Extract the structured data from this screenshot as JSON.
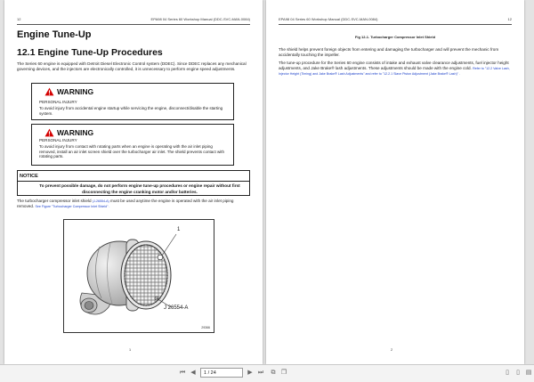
{
  "left_page": {
    "running_header_left": "12",
    "running_header_right": "EPA98 04 Series 60 Workshop Manual (DDC-SVC-MAN-0084)",
    "chapter_title": "Engine Tune-Up",
    "section_title": "12.1 Engine Tune-Up Procedures",
    "intro_text": "The Series 60 engine is equipped with Detroit Diesel Electronic Control system (DDEC). Since DDEC replaces any mechanical governing devices, and the injectors are electronically controlled, it is unnecessary to perform engine speed adjustments.",
    "warning1": {
      "title": "WARNING",
      "subtitle": "PERSONAL INJURY",
      "body": "To avoid injury from accidental engine startup while servicing the engine, disconnect/disable the starting system."
    },
    "warning2": {
      "title": "WARNING",
      "subtitle": "PERSONAL INJURY",
      "body": "To avoid injury from contact with rotating parts when an engine is operating with the air inlet piping removed, install an air inlet screen shield over the turbocharger air inlet. The shield prevents contact with rotating parts."
    },
    "notice": {
      "title": "NOTICE",
      "body": "To prevent possible damage, do not perform engine tune-up procedures or engine repair without first disconnecting the engine cranking motor and/or batteries."
    },
    "shield_text_a": "The turbocharger compressor inlet shield",
    "shield_part": "(J-26554-A)",
    "shield_text_b": "must be used anytime the engine is operated with the air inlet piping removed.",
    "shield_link": "See Figure \"Turbocharger Compressor Inlet Shield\" .",
    "figure": {
      "callout_1": "1",
      "callout_tool": "J 26554-A",
      "figure_number": "29366"
    },
    "page_number": "1"
  },
  "right_page": {
    "running_header_left": "EPA98 04 Series 60 Workshop Manual (DDC-SVC-MAN-0084)",
    "running_header_right": "12",
    "figure_caption": "Fig 12-1. Turbocharger Compressor Inlet Shield",
    "para1": "The shield helps prevent foreign objects from entering and damaging the turbocharger and will prevent the mechanic from accidentally touching the impeller.",
    "para2": "The tune-up procedure for the Series 60 engine consists of intake and exhaust valve clearance adjustments, fuel injector height adjustments, and Jake Brake® lash adjustments. These adjustments should be made with the engine cold.",
    "para2_links": "Refer to \"12.2 Valve Lash, Injector Height (Timing) and Jake Brake® Lash Adjustments\" and refer to \"12.2.1 Slave Piston Adjustment (Jake Brake® Lash)\" .",
    "page_number": "2"
  },
  "toolbar": {
    "page_field": "1 / 24"
  }
}
